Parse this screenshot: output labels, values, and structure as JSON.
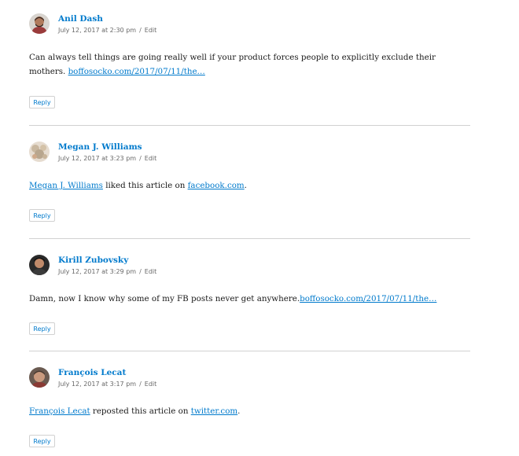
{
  "reply_label": "Reply",
  "edit_label": "Edit",
  "separator": "/",
  "colors": {
    "link": "#007acc",
    "meta": "#686868",
    "divider": "#d1d1d1",
    "text": "#1a1a1a"
  },
  "comments": [
    {
      "author": "Anil Dash",
      "date": "July 12, 2017 at 2:30 pm",
      "body_text": "Can always tell things are going really well if your product forces people to explicitly exclude their mothers. ",
      "body_link": "boffosocko.com/2017/07/11/the…",
      "avatar_icon": "person-avatar-icon"
    },
    {
      "author": "Megan J. Williams",
      "date": "July 12, 2017 at 3:23 pm",
      "body_link_author": "Megan J. Williams",
      "body_mid": " liked this article on ",
      "body_link_site": "facebook.com",
      "body_end": ".",
      "avatar_icon": "person-avatar-icon"
    },
    {
      "author": "Kirill Zubovsky",
      "date": "July 12, 2017 at 3:29 pm",
      "body_text": "Damn, now I know why some of my FB posts never get anywhere.",
      "body_link": "boffosocko.com/2017/07/11/the…",
      "avatar_icon": "person-avatar-icon"
    },
    {
      "author": "François Lecat",
      "date": "July 12, 2017 at 3:17 pm",
      "body_link_author": "François Lecat",
      "body_mid": " reposted this article on ",
      "body_link_site": "twitter.com",
      "body_end": ".",
      "avatar_icon": "person-avatar-icon"
    }
  ]
}
